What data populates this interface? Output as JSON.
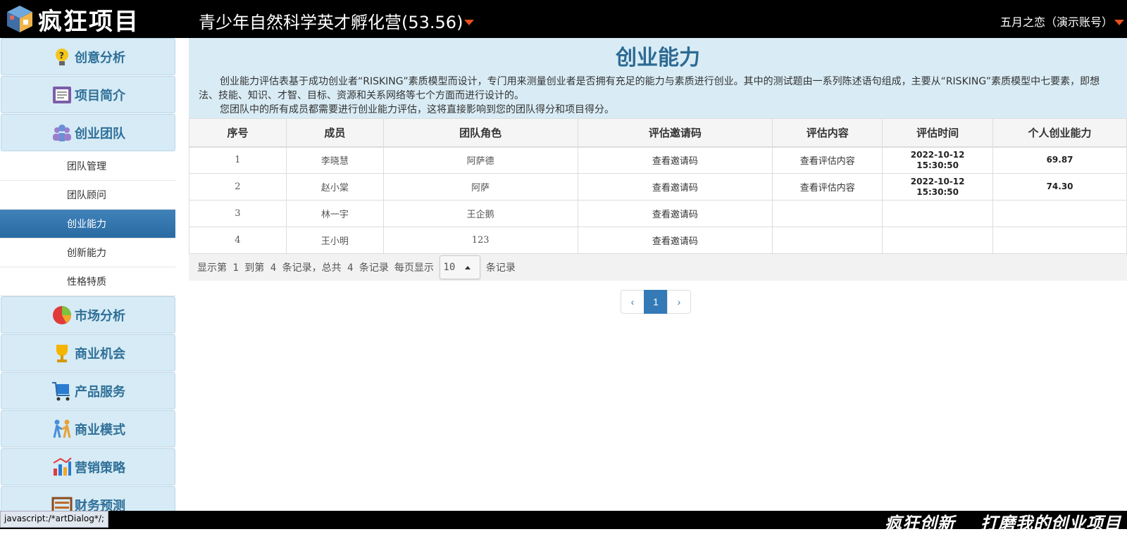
{
  "header": {
    "logo_text": "疯狂项目",
    "project_title": "青少年自然科学英才孵化营(53.56)",
    "user": "五月之恋（演示账号）"
  },
  "sidebar": {
    "sections": [
      {
        "label": "创意分析",
        "icon": "lightbulb-icon"
      },
      {
        "label": "项目简介",
        "icon": "document-icon"
      },
      {
        "label": "创业团队",
        "icon": "team-icon"
      }
    ],
    "sub_items": [
      {
        "label": "团队管理"
      },
      {
        "label": "团队顾问"
      },
      {
        "label": "创业能力"
      },
      {
        "label": "创新能力"
      },
      {
        "label": "性格特质"
      }
    ],
    "more_sections": [
      {
        "label": "市场分析",
        "icon": "pie-chart-icon"
      },
      {
        "label": "商业机会",
        "icon": "trophy-icon"
      },
      {
        "label": "产品服务",
        "icon": "cart-icon"
      },
      {
        "label": "商业模式",
        "icon": "handshake-icon"
      },
      {
        "label": "营销策略",
        "icon": "bar-chart-icon"
      },
      {
        "label": "财务预测",
        "icon": "abacus-icon"
      }
    ],
    "active_sub": "创业能力"
  },
  "main": {
    "title": "创业能力",
    "para1": "创业能力评估表基于成功创业者“RISKING”素质模型而设计，专门用来测量创业者是否拥有充足的能力与素质进行创业。其中的测试题由一系列陈述语句组成，主要从“RISKING”素质模型中七要素，即想法、技能、知识、才智、目标、资源和关系网络等七个方面而进行设计的。",
    "para2": "您团队中的所有成员都需要进行创业能力评估，这将直接影响到您的团队得分和项目得分。",
    "columns": [
      "序号",
      "成员",
      "团队角色",
      "评估邀请码",
      "评估内容",
      "评估时间",
      "个人创业能力"
    ],
    "rows": [
      {
        "no": "1",
        "member": "李晓慧",
        "role": "阿萨德",
        "invite": "查看邀请码",
        "content": "查看评估内容",
        "date": "2022-10-12",
        "time": "15:30:50",
        "score": "69.87"
      },
      {
        "no": "2",
        "member": "赵小棠",
        "role": "阿萨",
        "invite": "查看邀请码",
        "content": "查看评估内容",
        "date": "2022-10-12",
        "time": "15:30:50",
        "score": "74.30"
      },
      {
        "no": "3",
        "member": "林一宇",
        "role": "王企鹅",
        "invite": "查看邀请码",
        "content": "",
        "date": "",
        "time": "",
        "score": ""
      },
      {
        "no": "4",
        "member": "王小明",
        "role": "123",
        "invite": "查看邀请码",
        "content": "",
        "date": "",
        "time": "",
        "score": ""
      }
    ],
    "pager": {
      "summary": "显示第 1 到第 4 条记录，总共 4 条记录",
      "per_page_label": "每页显示",
      "page_size": "10",
      "suffix": "条记录",
      "prev": "‹",
      "current": "1",
      "next": "›"
    }
  },
  "footer": {
    "status": "javascript:/*artDialog*/;",
    "slogan1": "疯狂创新",
    "slogan2": "打磨我的创业项目"
  },
  "colors": {
    "accent": "#337ab7",
    "title": "#2d6a93",
    "caret": "#e8501c",
    "menu_bg": "#d6ebf5"
  }
}
